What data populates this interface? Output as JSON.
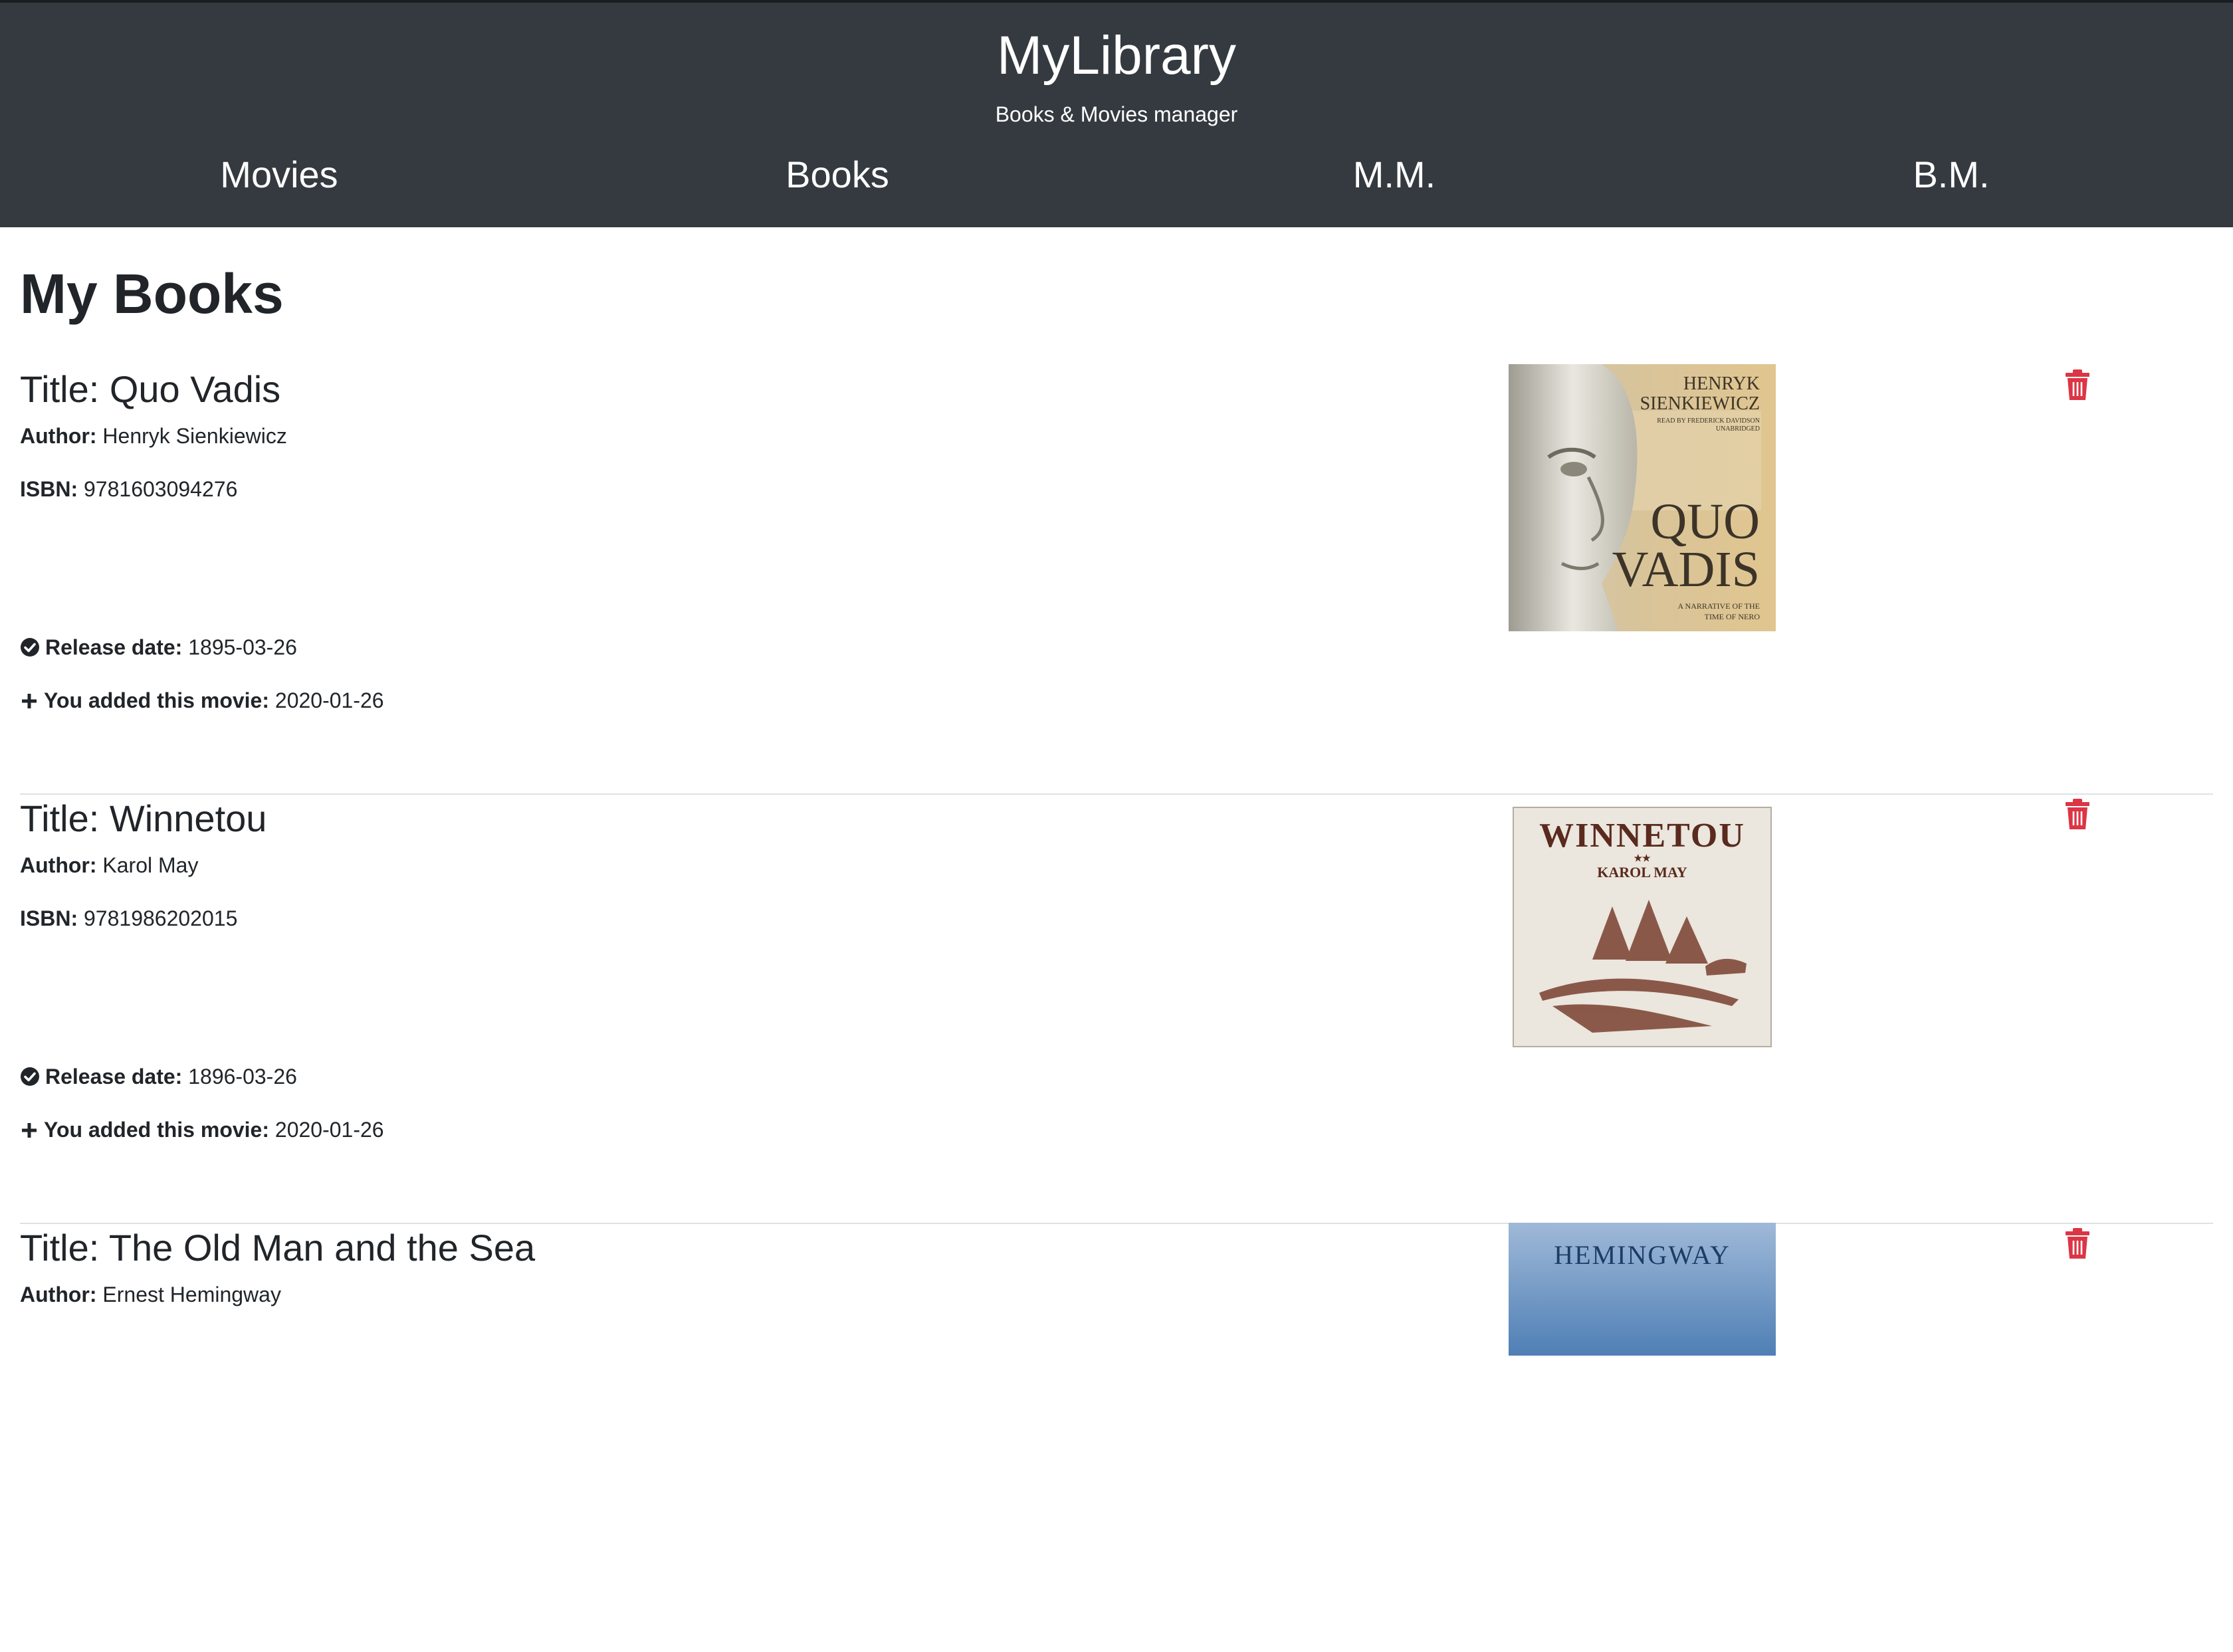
{
  "header": {
    "title": "MyLibrary",
    "subtitle": "Books & Movies manager",
    "nav": [
      "Movies",
      "Books",
      "M.M.",
      "B.M."
    ]
  },
  "page": {
    "heading": "My Books"
  },
  "labels": {
    "author": "Author:",
    "isbn": "ISBN:",
    "release_date": "Release date:",
    "added": "You added this movie:"
  },
  "icons": {
    "release": "check-circle-icon",
    "added": "plus-icon",
    "delete": "trash-icon"
  },
  "colors": {
    "header_bg": "#343a40",
    "delete": "#dc3545"
  },
  "books": [
    {
      "title": "Title: Quo Vadis",
      "author": "Henryk Sienkiewicz",
      "isbn": "9781603094276",
      "release_date": "1895-03-26",
      "added": "2020-01-26",
      "cover_text": [
        "HENRYK",
        "SIENKIEWICZ",
        "READ BY FREDERICK DAVIDSON",
        "UNABRIDGED",
        "QUO",
        "VADIS",
        "A NARRATIVE OF THE",
        "TIME OF NERO"
      ]
    },
    {
      "title": "Title: Winnetou",
      "author": "Karol May",
      "isbn": "9781986202015",
      "release_date": "1896-03-26",
      "added": "2020-01-26",
      "cover_text": [
        "WINNETOU",
        "KAROL MAY"
      ]
    },
    {
      "title": "Title: The Old Man and the Sea",
      "author": "Ernest Hemingway",
      "cover_text": [
        "HEMINGWAY"
      ]
    }
  ]
}
